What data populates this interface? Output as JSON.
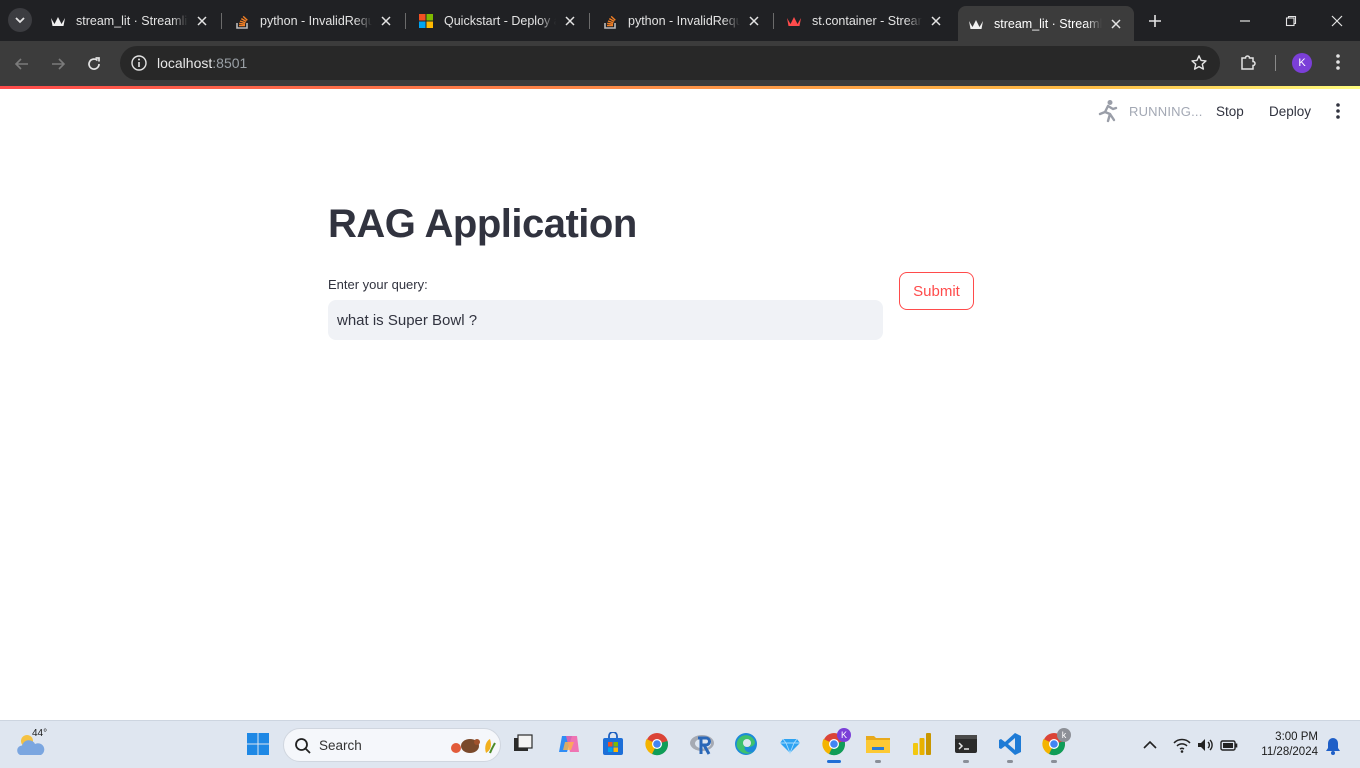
{
  "browser": {
    "tabs": [
      {
        "title": "stream_lit · Streamlit",
        "favicon": "streamlit-crown-icon",
        "active": false
      },
      {
        "title": "python - InvalidRequ",
        "favicon": "stackoverflow-icon",
        "active": false
      },
      {
        "title": "Quickstart - Deploy a",
        "favicon": "microsoft-icon",
        "active": false
      },
      {
        "title": "python - InvalidRequ",
        "favicon": "stackoverflow-icon",
        "active": false
      },
      {
        "title": "st.container - Stream",
        "favicon": "streamlit-crown-icon",
        "active": false
      },
      {
        "title": "stream_lit · Streamlit",
        "favicon": "streamlit-crown-icon",
        "active": true
      }
    ],
    "address": {
      "host": "localhost",
      "port": ":8501"
    },
    "profile_initial": "K"
  },
  "streamlit": {
    "status": "RUNNING...",
    "stop_label": "Stop",
    "deploy_label": "Deploy",
    "title": "RAG Application",
    "query_label": "Enter your query:",
    "query_value": "what is Super Bowl ?",
    "submit_label": "Submit",
    "colors": {
      "accent": "#ff4b4b",
      "text": "#31333f",
      "input_bg": "#f0f2f6"
    }
  },
  "taskbar": {
    "weather_temp": "44°",
    "search_label": "Search",
    "apps": [
      "start-icon",
      "file-explorer-icon",
      "copilot-icon",
      "store-icon",
      "chrome-icon",
      "r-icon",
      "edge-icon",
      "gem-icon",
      "chrome-profile-k-icon",
      "folder-icon",
      "powerbi-icon",
      "terminal-icon",
      "vscode-icon",
      "chrome-profile-k2-icon"
    ],
    "chrome_badge_1": "K",
    "chrome_badge_2": "k",
    "time": "3:00 PM",
    "date": "11/28/2024"
  }
}
